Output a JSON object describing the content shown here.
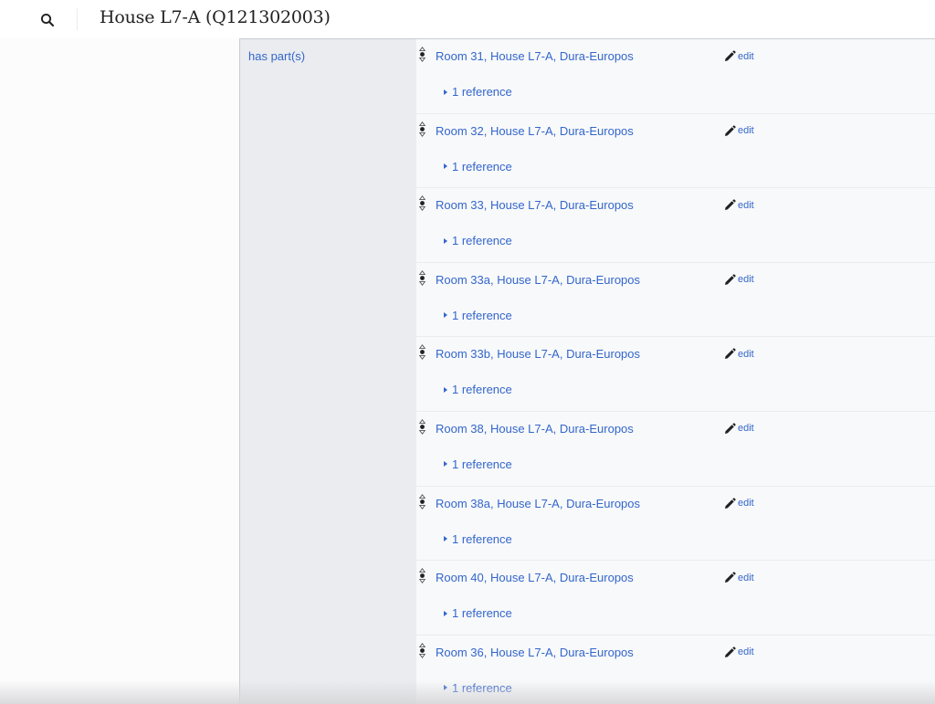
{
  "header": {
    "title": "House L7-A (Q121302003)",
    "search_icon": "search-icon"
  },
  "statement_group": {
    "property_label": "has part(s)",
    "statements": [
      {
        "value": "Room 31, House L7-A, Dura-Europos",
        "edit_label": "edit",
        "references_label": "1 reference"
      },
      {
        "value": "Room 32, House L7-A, Dura-Europos",
        "edit_label": "edit",
        "references_label": "1 reference"
      },
      {
        "value": "Room 33, House L7-A, Dura-Europos",
        "edit_label": "edit",
        "references_label": "1 reference"
      },
      {
        "value": "Room 33a, House L7-A, Dura-Europos",
        "edit_label": "edit",
        "references_label": "1 reference"
      },
      {
        "value": "Room 33b, House L7-A, Dura-Europos",
        "edit_label": "edit",
        "references_label": "1 reference"
      },
      {
        "value": "Room 38, House L7-A, Dura-Europos",
        "edit_label": "edit",
        "references_label": "1 reference"
      },
      {
        "value": "Room 38a, House L7-A, Dura-Europos",
        "edit_label": "edit",
        "references_label": "1 reference"
      },
      {
        "value": "Room 40, House L7-A, Dura-Europos",
        "edit_label": "edit",
        "references_label": "1 reference"
      },
      {
        "value": "Room 36, House L7-A, Dura-Europos",
        "edit_label": "edit",
        "references_label": "1 reference"
      }
    ]
  },
  "colors": {
    "link": "#3366cc",
    "property_bg": "#eaecf0",
    "value_bg": "#f8f9fa",
    "title": "#202122"
  }
}
